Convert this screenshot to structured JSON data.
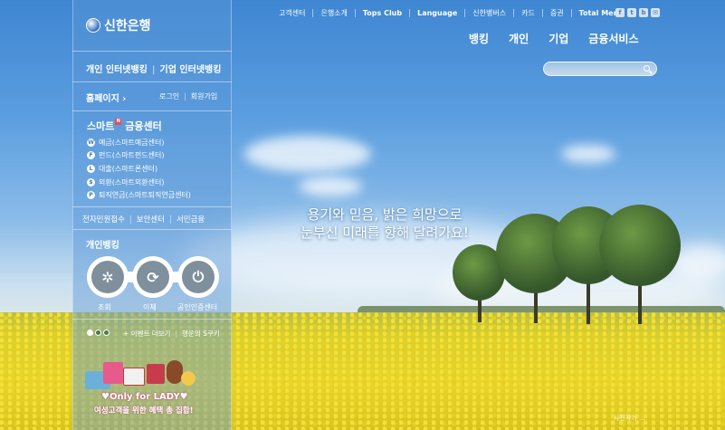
{
  "brand": {
    "logo_text": "신한은행"
  },
  "utility_nav": [
    "고객센터",
    "은행소개",
    "Tops Club",
    "Language",
    "신한뱅버스",
    "카드",
    "증권",
    "Total Menu"
  ],
  "social_icons": [
    "facebook-icon",
    "twitter-icon",
    "blog-icon",
    "mail-icon"
  ],
  "main_nav": [
    "뱅킹",
    "개인",
    "기업",
    "금융서비스"
  ],
  "search": {
    "placeholder": ""
  },
  "left": {
    "banking_personal": "개인 인터넷뱅킹",
    "banking_corporate": "기업 인터넷뱅킹",
    "homepage": "홈페이지",
    "homepage_arrow": "›",
    "login": "로그인",
    "join": "회원가입",
    "smart_title": "스마트",
    "smart_badge": "N",
    "smart_title2": "금융센터",
    "smart_items": [
      {
        "label": "예금(스마트예금센터)",
        "icon": "W"
      },
      {
        "label": "펀드(스마트펀드센터)",
        "icon": "F"
      },
      {
        "label": "대출(스마트론센터)",
        "icon": "L"
      },
      {
        "label": "외환(스마트외환센터)",
        "icon": "$"
      },
      {
        "label": "퇴직연금(스마트퇴직연금센터)",
        "icon": "P"
      }
    ],
    "quick_links": [
      "전자민원접수",
      "보안센터",
      "서민금융"
    ],
    "personal_banking_title": "개인뱅킹",
    "bank_actions": [
      {
        "label": "조회",
        "icon": "settings-icon"
      },
      {
        "label": "이체",
        "icon": "transfer-icon"
      },
      {
        "label": "공인인증센터",
        "icon": "power-icon"
      }
    ],
    "events_more": "+ 이벤트 더보기",
    "cookie_link": "행운의 S쿠키",
    "promo_title": "♥Only for LADY♥",
    "promo_sub": "여성고객을 위한 혜택 총 집합!"
  },
  "hero": {
    "slogan_line1": "용기와 믿음, 밝은 희망으로",
    "slogan_line2": "눈부신 미래를 향해 달려가요!",
    "photo_credit": "사진작가 ..."
  },
  "colors": {
    "sky": "#5c9fe0",
    "field": "#e9d52a",
    "panel": "#5a96d7"
  }
}
